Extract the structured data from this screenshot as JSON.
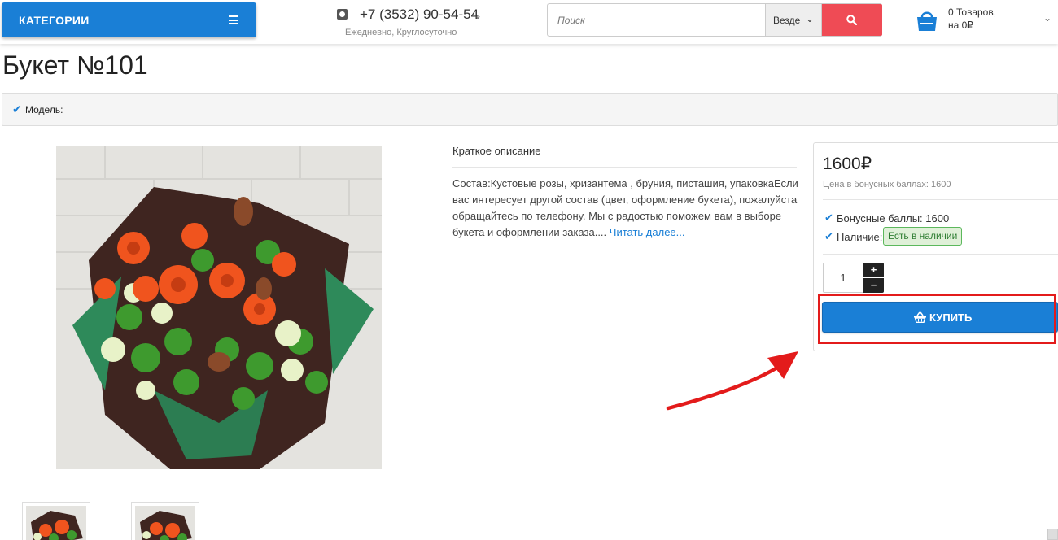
{
  "header": {
    "categories_label": "КАТЕГОРИИ",
    "phone_number": "+7 (3532) 90-54-54",
    "phone_hours": "Ежедневно, Круглосуточно",
    "search_placeholder": "Поиск",
    "search_scope": "Везде",
    "cart_items": "0 Товаров,",
    "cart_total": "на 0₽"
  },
  "product": {
    "title": "Букет №101",
    "model_label": "Модель:",
    "description_heading": "Краткое описание",
    "description": "Состав:Кустовые розы, хризантема , бруния, писташия, упаковкаЕсли вас интересует другой состав (цвет, оформление букета), пожалуйста обращайтесь по телефону. Мы с радостью поможем вам в выборе букета и оформлении заказа....",
    "read_more": "Читать далее...",
    "price": "1600₽",
    "bonus_price": "Цена в бонусных баллах: 1600",
    "bonus_points": "Бонусные баллы: 1600",
    "availability_label": "Наличие:",
    "availability_value": "Есть в наличии",
    "quantity": "1",
    "qty_plus": "+",
    "qty_minus": "−",
    "buy_label": "КУПИТЬ"
  },
  "colors": {
    "primary_blue": "#1a7fd6",
    "search_red": "#ef4b55",
    "in_stock_green": "#5cb85c",
    "annotation_red": "#e31b1b"
  }
}
